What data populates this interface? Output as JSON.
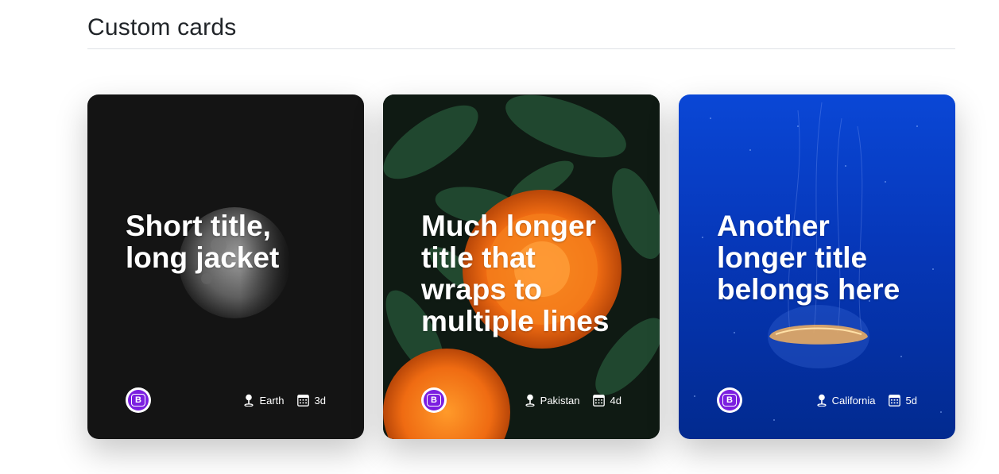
{
  "section": {
    "title": "Custom cards"
  },
  "cards": [
    {
      "title": "Short title, long jacket",
      "location": "Earth",
      "time": "3d",
      "logo_icon": "bootstrap-logo-icon"
    },
    {
      "title": "Much longer title that wraps to multiple lines",
      "location": "Pakistan",
      "time": "4d",
      "logo_icon": "bootstrap-logo-icon"
    },
    {
      "title": "Another longer title belongs here",
      "location": "California",
      "time": "5d",
      "logo_icon": "bootstrap-logo-icon"
    }
  ],
  "icons": {
    "location": "geo-pin-icon",
    "calendar": "calendar-icon"
  },
  "colors": {
    "brand_purple": "#7b1ee0",
    "card_dark": "#141414",
    "card_blue": "#0637b8"
  }
}
